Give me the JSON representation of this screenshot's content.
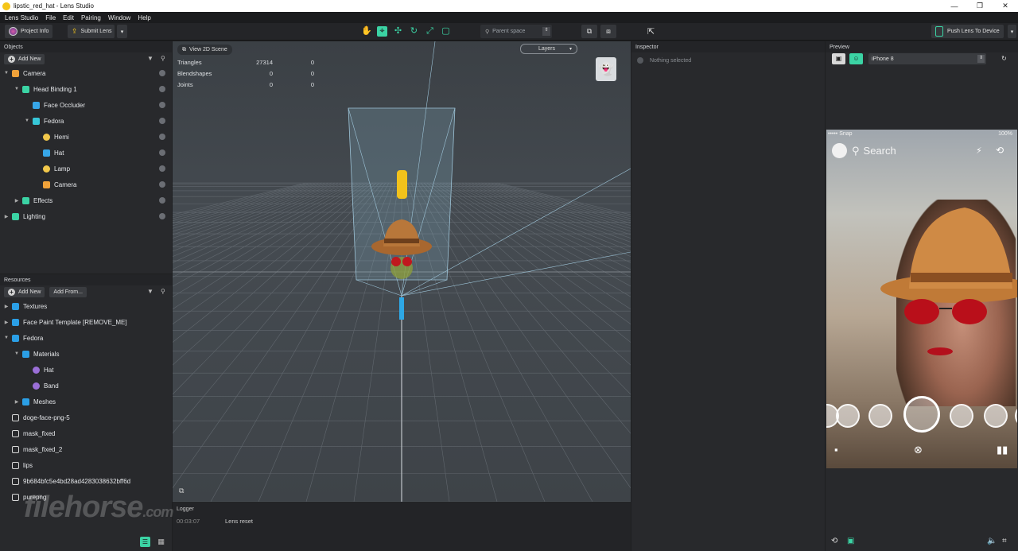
{
  "window": {
    "title": "lipstic_red_hat - Lens Studio",
    "controls": [
      "—",
      "❐",
      "✕"
    ]
  },
  "menu": [
    "Lens Studio",
    "File",
    "Edit",
    "Pairing",
    "Window",
    "Help"
  ],
  "toolbar": {
    "project_info": "Project Info",
    "submit_lens": "Submit Lens",
    "space": "Parent space",
    "push_lens": "Push Lens To Device"
  },
  "objects": {
    "title": "Objects",
    "add_new": "Add New",
    "items": [
      {
        "label": "Camera",
        "depth": 0,
        "expanded": true,
        "icon": "camera-icon",
        "color": "#f0a23a"
      },
      {
        "label": "Head Binding 1",
        "depth": 1,
        "expanded": true,
        "icon": "head-binding-icon",
        "color": "#3bd3a4"
      },
      {
        "label": "Face Occluder",
        "depth": 2,
        "expanded": null,
        "icon": "mesh-icon",
        "color": "#37a6e8"
      },
      {
        "label": "Fedora",
        "depth": 2,
        "expanded": true,
        "icon": "object-icon",
        "color": "#37c7d8"
      },
      {
        "label": "Hemi",
        "depth": 3,
        "expanded": null,
        "icon": "light-icon",
        "color": "#f2c84b"
      },
      {
        "label": "Hat",
        "depth": 3,
        "expanded": null,
        "icon": "mesh-icon",
        "color": "#37a6e8"
      },
      {
        "label": "Lamp",
        "depth": 3,
        "expanded": null,
        "icon": "light-icon",
        "color": "#f2c84b"
      },
      {
        "label": "Camera",
        "depth": 3,
        "expanded": null,
        "icon": "camera-icon",
        "color": "#f0a23a"
      },
      {
        "label": "Effects",
        "depth": 1,
        "expanded": false,
        "icon": "object-icon",
        "color": "#3bd3a4"
      },
      {
        "label": "Lighting",
        "depth": 0,
        "expanded": false,
        "icon": "object-icon",
        "color": "#3bd3a4"
      }
    ]
  },
  "resources": {
    "title": "Resources",
    "add_new": "Add New",
    "add_from": "Add From...",
    "items": [
      {
        "label": "Textures",
        "depth": 0,
        "expanded": false,
        "icon": "folder-icon",
        "color": "#2b9fe6"
      },
      {
        "label": "Face Paint Template [REMOVE_ME]",
        "depth": 0,
        "expanded": false,
        "icon": "folder-icon",
        "color": "#2b9fe6"
      },
      {
        "label": "Fedora",
        "depth": 0,
        "expanded": true,
        "icon": "folder-icon",
        "color": "#2b9fe6"
      },
      {
        "label": "Materials",
        "depth": 1,
        "expanded": true,
        "icon": "folder-icon",
        "color": "#2b9fe6"
      },
      {
        "label": "Hat",
        "depth": 2,
        "expanded": null,
        "icon": "material-icon",
        "color": "#9b6fd8"
      },
      {
        "label": "Band",
        "depth": 2,
        "expanded": null,
        "icon": "material-icon",
        "color": "#9b6fd8"
      },
      {
        "label": "Meshes",
        "depth": 1,
        "expanded": false,
        "icon": "folder-icon",
        "color": "#2b9fe6"
      },
      {
        "label": "doge-face-png-5",
        "depth": 0,
        "expanded": null,
        "icon": "image-icon",
        "color": "#d8d8d8"
      },
      {
        "label": "mask_fixed",
        "depth": 0,
        "expanded": null,
        "icon": "image-icon",
        "color": "#d8d8d8"
      },
      {
        "label": "mask_fixed_2",
        "depth": 0,
        "expanded": null,
        "icon": "image-icon",
        "color": "#d8d8d8"
      },
      {
        "label": "lips",
        "depth": 0,
        "expanded": null,
        "icon": "image-icon",
        "color": "#d8d8d8"
      },
      {
        "label": "9b684bfc5e4bd28ad4283038632bff6d",
        "depth": 0,
        "expanded": null,
        "icon": "image-icon",
        "color": "#d8d8d8"
      },
      {
        "label": "purepng",
        "depth": 0,
        "expanded": null,
        "icon": "image-icon",
        "color": "#d8d8d8"
      }
    ]
  },
  "viewport": {
    "view_2d": "View 2D Scene",
    "layers": "Layers",
    "stats": [
      {
        "name": "Triangles",
        "a": "27314",
        "b": "0"
      },
      {
        "name": "Blendshapes",
        "a": "0",
        "b": "0"
      },
      {
        "name": "Joints",
        "a": "0",
        "b": "0"
      }
    ]
  },
  "logger": {
    "title": "Logger",
    "time": "00:03:07",
    "message": "Lens reset"
  },
  "inspector": {
    "title": "Inspector",
    "empty": "Nothing selected"
  },
  "preview": {
    "title": "Preview",
    "device": "iPhone 8",
    "status_left": "••••• Snap",
    "status_right": "100%",
    "search": "Search"
  },
  "watermark": {
    "brand": "filehorse",
    "suffix": ".com"
  },
  "colors": {
    "accent": "#3bd3a4",
    "panel": "#28292c",
    "background": "#1e1f21"
  }
}
